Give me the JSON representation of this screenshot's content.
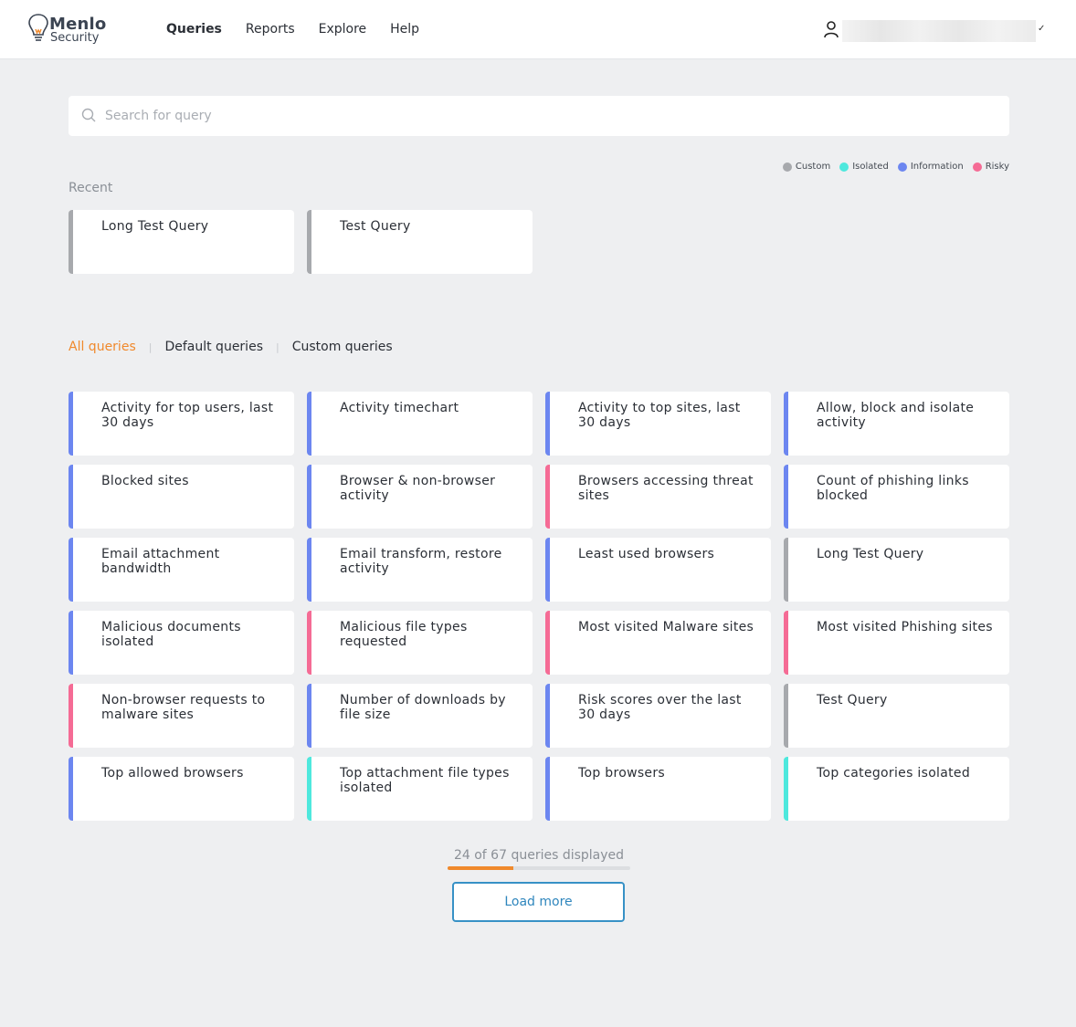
{
  "app": {
    "brand_top": "Menlo",
    "brand_bottom": "Security"
  },
  "nav": {
    "items": [
      "Queries",
      "Reports",
      "Explore",
      "Help"
    ],
    "active": "Queries"
  },
  "user": {
    "icon": "user-icon",
    "chevron": "✓"
  },
  "search": {
    "placeholder": "Search for query",
    "value": ""
  },
  "legend": [
    {
      "label": "Custom",
      "color": "#a7a9ad"
    },
    {
      "label": "Isolated",
      "color": "#4ee8dd"
    },
    {
      "label": "Information",
      "color": "#6c86f0"
    },
    {
      "label": "Risky",
      "color": "#f56b95"
    }
  ],
  "recent": {
    "label": "Recent",
    "items": [
      {
        "title": "Long Test Query",
        "type": "Custom"
      },
      {
        "title": "Test Query",
        "type": "Custom"
      }
    ]
  },
  "tabs": {
    "items": [
      "All queries",
      "Default queries",
      "Custom queries"
    ],
    "active": "All queries"
  },
  "queries": [
    {
      "title": "Activity for top users, last 30 days",
      "type": "Information"
    },
    {
      "title": "Activity timechart",
      "type": "Information"
    },
    {
      "title": "Activity to top sites, last 30 days",
      "type": "Information"
    },
    {
      "title": "Allow, block and isolate activity",
      "type": "Information"
    },
    {
      "title": "Blocked sites",
      "type": "Information"
    },
    {
      "title": "Browser & non-browser activity",
      "type": "Information"
    },
    {
      "title": "Browsers accessing threat sites",
      "type": "Risky"
    },
    {
      "title": "Count of phishing links blocked",
      "type": "Information"
    },
    {
      "title": "Email attachment bandwidth",
      "type": "Information"
    },
    {
      "title": "Email transform, restore activity",
      "type": "Information"
    },
    {
      "title": "Least used browsers",
      "type": "Information"
    },
    {
      "title": "Long Test Query",
      "type": "Custom"
    },
    {
      "title": "Malicious documents isolated",
      "type": "Information"
    },
    {
      "title": "Malicious file types requested",
      "type": "Risky"
    },
    {
      "title": "Most visited Malware sites",
      "type": "Risky"
    },
    {
      "title": "Most visited Phishing sites",
      "type": "Risky"
    },
    {
      "title": "Non-browser requests to malware sites",
      "type": "Risky"
    },
    {
      "title": "Number of downloads by file size",
      "type": "Information"
    },
    {
      "title": "Risk scores over the last 30 days",
      "type": "Information"
    },
    {
      "title": "Test Query",
      "type": "Custom"
    },
    {
      "title": "Top allowed browsers",
      "type": "Information"
    },
    {
      "title": "Top attachment file types isolated",
      "type": "Isolated"
    },
    {
      "title": "Top browsers",
      "type": "Information"
    },
    {
      "title": "Top categories isolated",
      "type": "Isolated"
    }
  ],
  "footer": {
    "count_text": "24 of 67 queries displayed",
    "progress": 0.358,
    "load_more_label": "Load more"
  }
}
